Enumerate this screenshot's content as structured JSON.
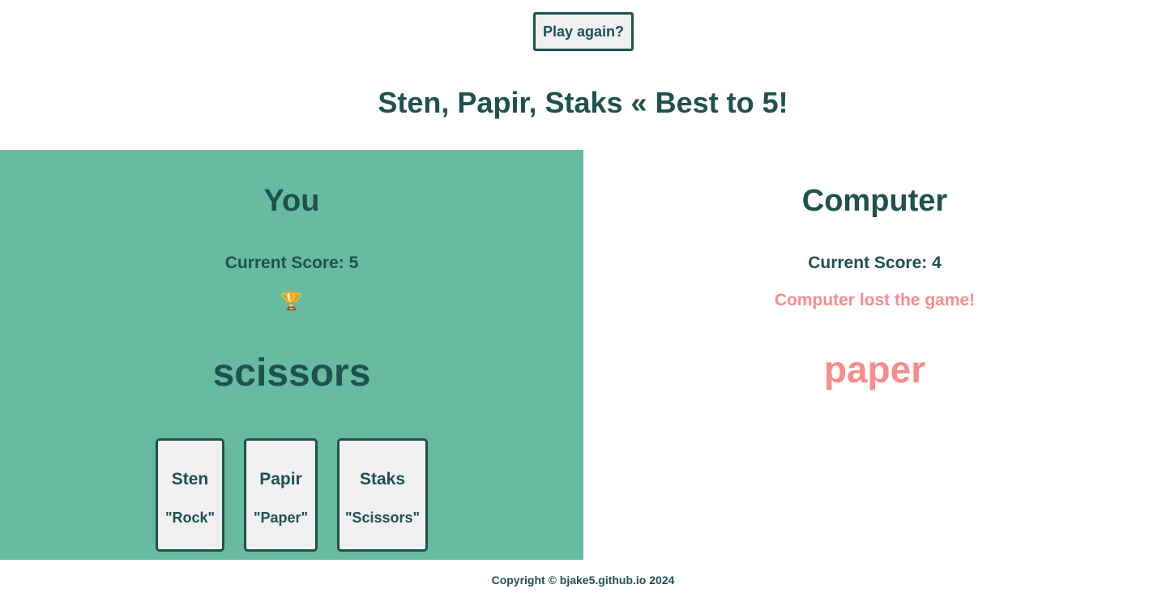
{
  "header": {
    "play_again_label": "Play again?",
    "title": "Sten, Papir, Staks « Best to 5!"
  },
  "player": {
    "heading": "You",
    "score_label": "Current Score: 5",
    "status_icon": "trophy-icon",
    "status_glyph": "🏆",
    "choice": "scissors",
    "cards": [
      {
        "name": "Sten",
        "translation": "\"Rock\""
      },
      {
        "name": "Papir",
        "translation": "\"Paper\""
      },
      {
        "name": "Staks",
        "translation": "\"Scissors\""
      }
    ]
  },
  "computer": {
    "heading": "Computer",
    "score_label": "Current Score: 4",
    "status_message": "Computer lost the game!",
    "choice": "paper"
  },
  "footer": {
    "copyright": "Copyright © bjake5.github.io 2024"
  },
  "colors": {
    "primary_text": "#1f514e",
    "player_panel_bg": "#67bba0",
    "loss_accent": "#f78c8c",
    "button_bg": "#f0f0f0"
  }
}
